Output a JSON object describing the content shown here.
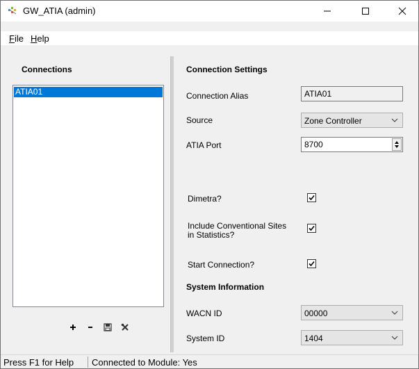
{
  "window": {
    "title": "GW_ATIA (admin)",
    "controls": {
      "minimize": "–",
      "maximize": "☐",
      "close": "✕"
    }
  },
  "menu": {
    "file": "File",
    "help": "Help"
  },
  "connections": {
    "title": "Connections",
    "items": [
      "ATIA01"
    ],
    "selected": "ATIA01",
    "tools": [
      "add-icon",
      "remove-icon",
      "save-icon",
      "tools-icon"
    ]
  },
  "settings": {
    "title": "Connection Settings",
    "alias_label": "Connection Alias",
    "alias_value": "ATIA01",
    "source_label": "Source",
    "source_value": "Zone Controller",
    "port_label": "ATIA Port",
    "port_value": "8700",
    "dimetra_label": "Dimetra?",
    "dimetra_checked": true,
    "include_label_line1": "Include Conventional Sites",
    "include_label_line2": "in Statistics?",
    "include_checked": true,
    "start_label": "Start Connection?",
    "start_checked": true
  },
  "system": {
    "title": "System Information",
    "wacn_label": "WACN ID",
    "wacn_value": "00000",
    "sysid_label": "System ID",
    "sysid_value": "1404"
  },
  "status": {
    "help": "Press F1 for Help",
    "module": "Connected to Module: Yes"
  },
  "colors": {
    "selection": "#0078d7",
    "panel": "#f0f0f0"
  }
}
